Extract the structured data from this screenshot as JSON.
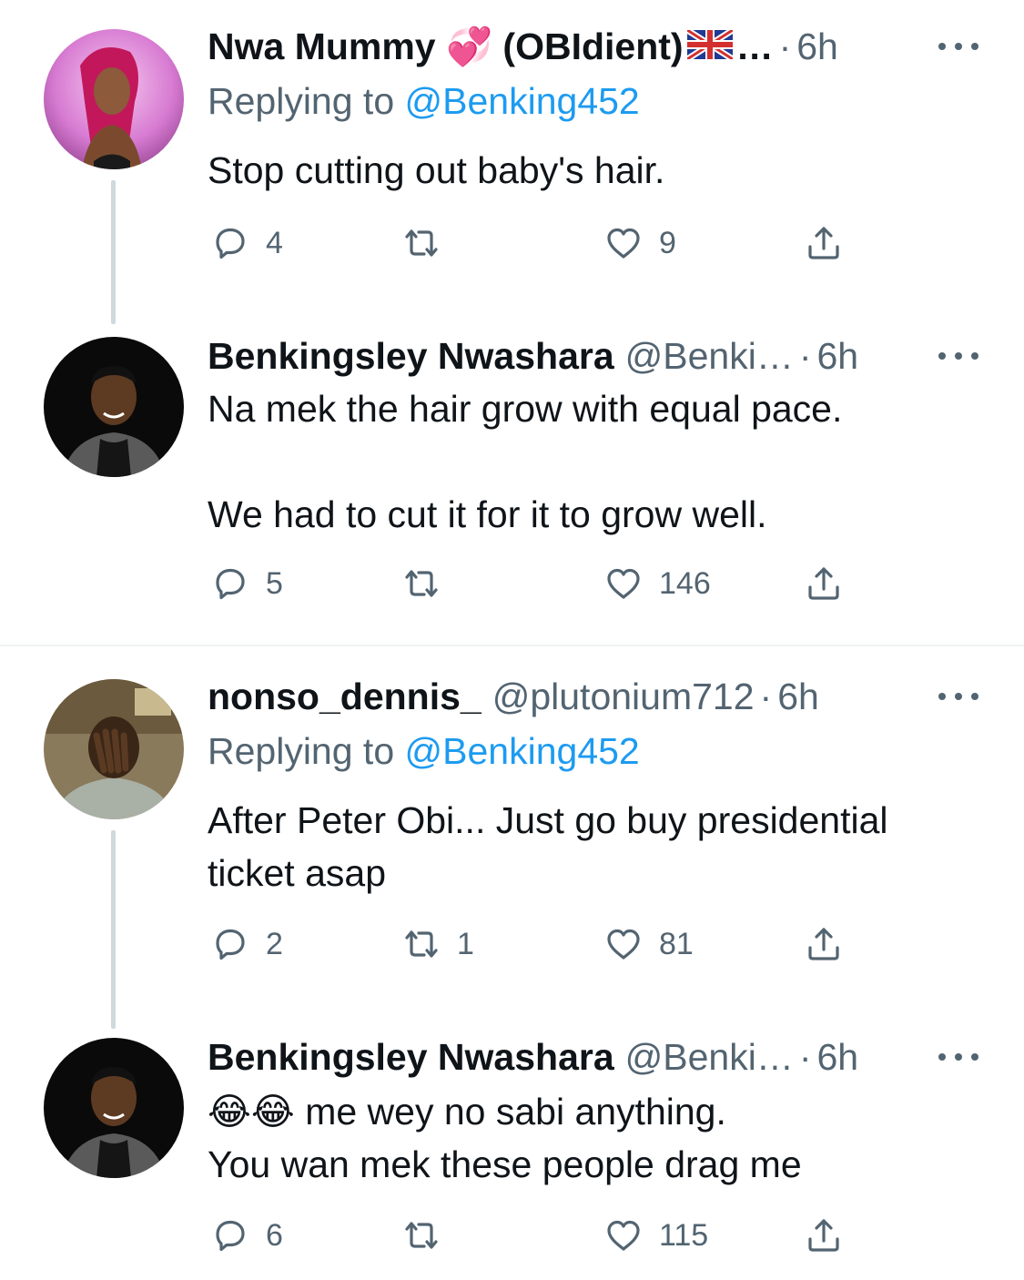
{
  "tweets": [
    {
      "name": "Nwa Mummy 💞 (OBIdient)",
      "name_trunc": "…",
      "handle": "",
      "time": "6h",
      "replying_label": "Replying to",
      "replying_to": "@Benking452",
      "text": "Stop cutting out baby's hair.",
      "replies": "4",
      "retweets": "",
      "likes": "9"
    },
    {
      "name": "Benkingsley Nwashara",
      "handle": "@Benki…",
      "time": "6h",
      "text_line1": "Na mek the hair grow with equal pace.",
      "text_line2": "We had to cut it for it to grow well.",
      "replies": "5",
      "retweets": "",
      "likes": "146"
    },
    {
      "name": "nonso_dennis_",
      "handle": "@plutonium712",
      "time": "6h",
      "replying_label": "Replying to",
      "replying_to": "@Benking452",
      "text": "After Peter Obi... Just go buy presidential ticket asap",
      "replies": "2",
      "retweets": "1",
      "likes": "81"
    },
    {
      "name": "Benkingsley Nwashara",
      "handle": "@Benki…",
      "time": "6h",
      "text_line1": "😂😂 me wey no sabi anything.",
      "text_line2": "You wan mek these people drag me",
      "replies": "6",
      "retweets": "",
      "likes": "115"
    }
  ],
  "separator": "·",
  "icons": {
    "reply": "reply-icon",
    "retweet": "retweet-icon",
    "like": "heart-icon",
    "share": "share-icon",
    "more": "more-icon",
    "flag": "uk-flag-icon"
  },
  "colors": {
    "text": "#0f1419",
    "secondary": "#536471",
    "link": "#1d9bf0",
    "thread_line": "#cfd9de",
    "divider": "#eff3f4"
  }
}
